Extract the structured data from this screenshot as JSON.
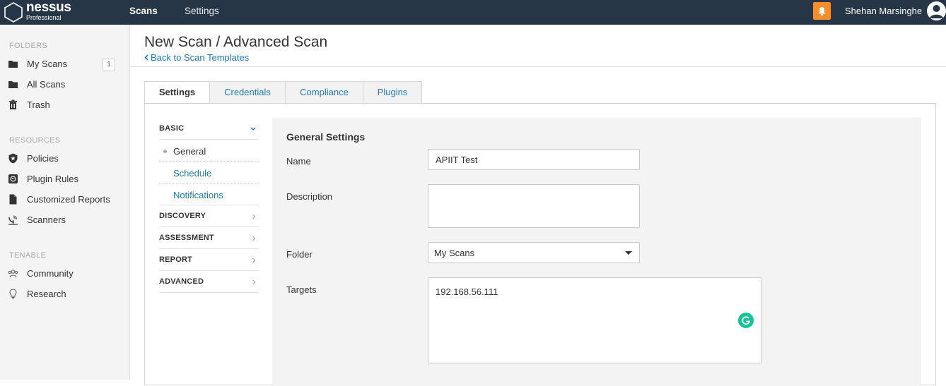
{
  "topbar": {
    "brand": "nessus",
    "edition": "Professional",
    "nav": {
      "scans": "Scans",
      "settings": "Settings"
    },
    "user_name": "Shehan Marsinghe",
    "colors": {
      "bar": "#263646",
      "bell": "#f28e2b"
    }
  },
  "sidebar": {
    "folders_title": "FOLDERS",
    "folders": [
      {
        "label": "My Scans",
        "icon": "folder-icon",
        "count": "1"
      },
      {
        "label": "All Scans",
        "icon": "folder-icon"
      },
      {
        "label": "Trash",
        "icon": "trash-icon"
      }
    ],
    "resources_title": "RESOURCES",
    "resources": [
      {
        "label": "Policies",
        "icon": "shield-icon"
      },
      {
        "label": "Plugin Rules",
        "icon": "plugin-rules-icon"
      },
      {
        "label": "Customized Reports",
        "icon": "document-icon"
      },
      {
        "label": "Scanners",
        "icon": "satellite-icon"
      }
    ],
    "tenable_title": "TENABLE",
    "tenable": [
      {
        "label": "Community",
        "icon": "community-icon"
      },
      {
        "label": "Research",
        "icon": "lightbulb-icon"
      }
    ]
  },
  "page": {
    "title": "New Scan / Advanced Scan",
    "back_link": "Back to Scan Templates"
  },
  "tabs": [
    "Settings",
    "Credentials",
    "Compliance",
    "Plugins"
  ],
  "active_tab": "Settings",
  "subnav": {
    "basic": "BASIC",
    "basic_items": [
      "General",
      "Schedule",
      "Notifications"
    ],
    "sections": [
      "DISCOVERY",
      "ASSESSMENT",
      "REPORT",
      "ADVANCED"
    ]
  },
  "general_settings": {
    "title": "General Settings",
    "name_label": "Name",
    "name_value": "APIIT Test",
    "description_label": "Description",
    "description_value": "",
    "folder_label": "Folder",
    "folder_value": "My Scans",
    "targets_label": "Targets",
    "targets_value": "192.168.56.111"
  },
  "accent_color": "#1f7ab9"
}
